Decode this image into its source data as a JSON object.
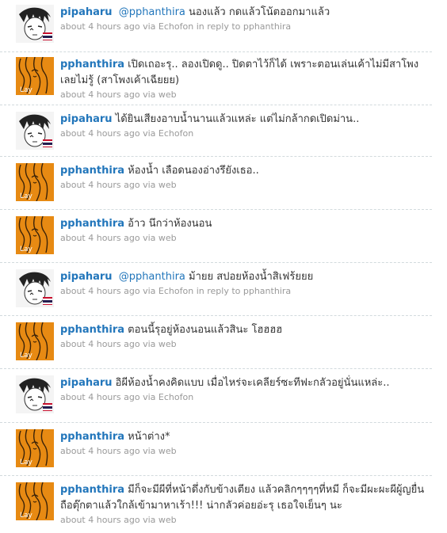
{
  "tweets": [
    {
      "user": "pipaharu",
      "avatar": "pipaharu-avatar",
      "mention": "@pphanthira",
      "text": " นองแล้ว กดแล้วโน้ตออกมาแล้ว",
      "time": "about 4 hours ago",
      "via_prefix": "via",
      "source": "Echofon",
      "reply_prefix": "in reply to",
      "reply_to": "pphanthira"
    },
    {
      "user": "pphanthira",
      "avatar": "pphanthira-avatar",
      "mention": "",
      "text": " เปิดเถอะรุ.. ลองเปิดดู.. ปิดตาไว้ก็ได้ เพราะตอนเล่นเค้าไม่มีสาโพงเลยไม่รู้ (สาโพงเค้าเฉียยย)",
      "time": "about 4 hours ago",
      "via_prefix": "via",
      "source": "web",
      "reply_prefix": "",
      "reply_to": ""
    },
    {
      "user": "pipaharu",
      "avatar": "pipaharu-avatar",
      "mention": "",
      "text": " ได้ยินเสียงอาบน้ำนานแล้วแหล่ะ แต่ไม่กล้ากดเปิดม่าน..",
      "time": "about 4 hours ago",
      "via_prefix": "via",
      "source": "Echofon",
      "reply_prefix": "",
      "reply_to": ""
    },
    {
      "user": "pphanthira",
      "avatar": "pphanthira-avatar",
      "mention": "",
      "text": " ห้องน้ำ เลือดนองอ่างรึยังเธอ..",
      "time": "about 4 hours ago",
      "via_prefix": "via",
      "source": "web",
      "reply_prefix": "",
      "reply_to": ""
    },
    {
      "user": "pphanthira",
      "avatar": "pphanthira-avatar",
      "mention": "",
      "text": " อ้าว นึกว่าห้องนอน",
      "time": "about 4 hours ago",
      "via_prefix": "via",
      "source": "web",
      "reply_prefix": "",
      "reply_to": ""
    },
    {
      "user": "pipaharu",
      "avatar": "pipaharu-avatar",
      "mention": "@pphanthira",
      "text": " ม้ายย สปอยห้องน้ำสิเฟร้ยยย",
      "time": "about 4 hours ago",
      "via_prefix": "via",
      "source": "Echofon",
      "reply_prefix": "in reply to",
      "reply_to": "pphanthira"
    },
    {
      "user": "pphanthira",
      "avatar": "pphanthira-avatar",
      "mention": "",
      "text": " ตอนนี้รุอยู่ห้องนอนแล้วสินะ โฮฮฮฮ",
      "time": "about 4 hours ago",
      "via_prefix": "via",
      "source": "web",
      "reply_prefix": "",
      "reply_to": ""
    },
    {
      "user": "pipaharu",
      "avatar": "pipaharu-avatar",
      "mention": "",
      "text": " อิผีห้องน้ำคงคิดแบบ เมื่อไหร่จะเคลียร์ซะทีฟะกลัวอยู่นั่นแหล่ะ..",
      "time": "about 4 hours ago",
      "via_prefix": "via",
      "source": "Echofon",
      "reply_prefix": "",
      "reply_to": ""
    },
    {
      "user": "pphanthira",
      "avatar": "pphanthira-avatar",
      "mention": "",
      "text": " หน้าต่าง*",
      "time": "about 4 hours ago",
      "via_prefix": "via",
      "source": "web",
      "reply_prefix": "",
      "reply_to": ""
    },
    {
      "user": "pphanthira",
      "avatar": "pphanthira-avatar",
      "mention": "",
      "text": " มีก็จะมีผีที่หน้าดึ่งกับข้างเตียง แล้วคลิกๆๆๆๆที่หมี ก็จะมีผะผะผีผู้ญยื่นถือตุ๊กตาแล้วใกล้เข้ามาหาเร้า!!! น่ากลัวค่อยอ่ะรุ เธอใจเย็นๆ นะ",
      "time": "about 4 hours ago",
      "via_prefix": "via",
      "source": "web",
      "reply_prefix": "",
      "reply_to": ""
    }
  ],
  "colors": {
    "username": "#2276bb",
    "text": "#333333",
    "meta": "#999999",
    "separator": "#d2dadd",
    "avatar_orange": "#e78a13"
  }
}
